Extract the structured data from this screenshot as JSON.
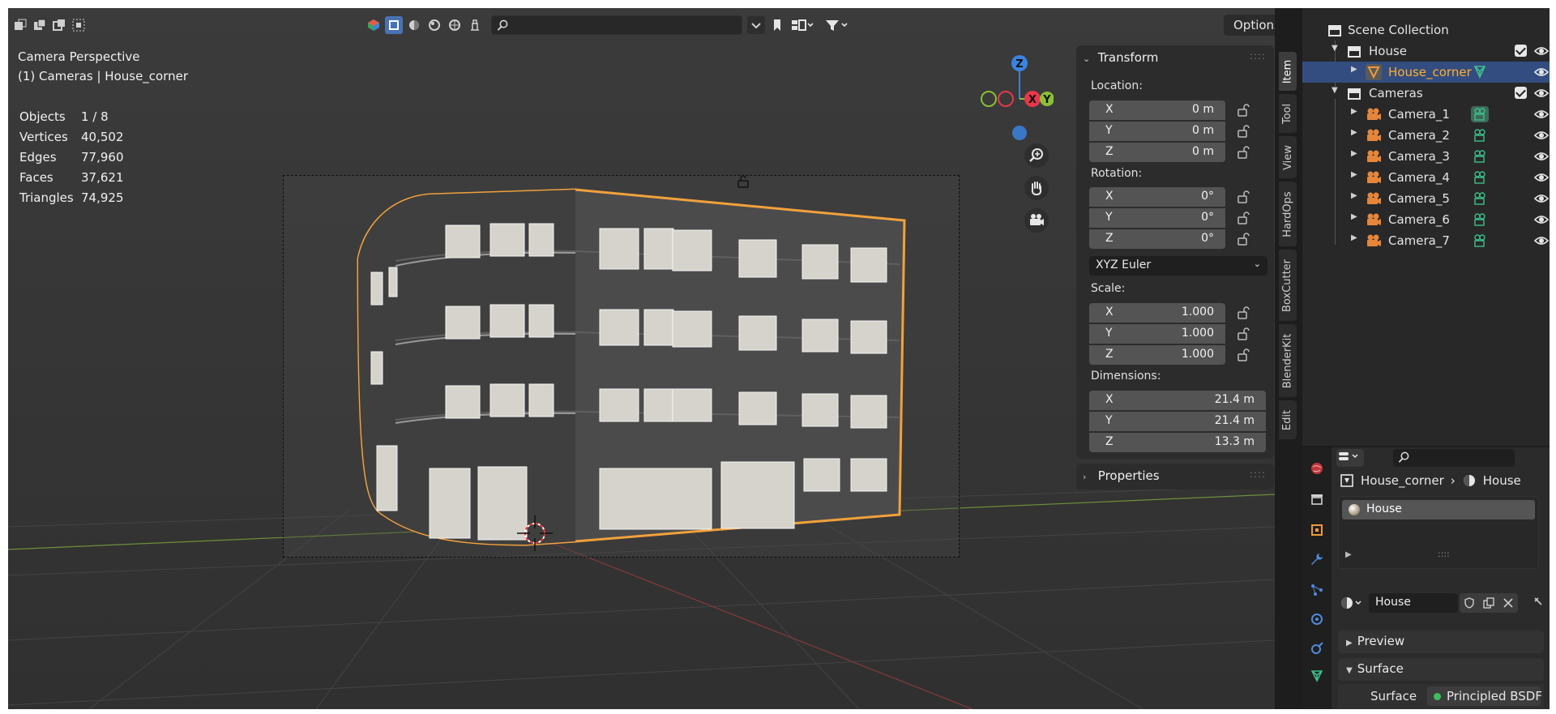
{
  "viewport": {
    "mode_label": "Camera Perspective",
    "context_label": "(1) Cameras | House_corner",
    "stats": [
      {
        "label": "Objects",
        "value": "1 / 8"
      },
      {
        "label": "Vertices",
        "value": "40,502"
      },
      {
        "label": "Edges",
        "value": "77,960"
      },
      {
        "label": "Faces",
        "value": "37,621"
      },
      {
        "label": "Triangles",
        "value": "74,925"
      }
    ],
    "options_label": "Options",
    "gizmo": {
      "x": "X",
      "y": "Y",
      "z": "Z"
    }
  },
  "npanel": {
    "transform": {
      "title": "Transform",
      "location_label": "Location:",
      "location": [
        {
          "axis": "X",
          "value": "0 m"
        },
        {
          "axis": "Y",
          "value": "0 m"
        },
        {
          "axis": "Z",
          "value": "0 m"
        }
      ],
      "rotation_label": "Rotation:",
      "rotation": [
        {
          "axis": "X",
          "value": "0°"
        },
        {
          "axis": "Y",
          "value": "0°"
        },
        {
          "axis": "Z",
          "value": "0°"
        }
      ],
      "rotation_mode": "XYZ Euler",
      "scale_label": "Scale:",
      "scale": [
        {
          "axis": "X",
          "value": "1.000"
        },
        {
          "axis": "Y",
          "value": "1.000"
        },
        {
          "axis": "Z",
          "value": "1.000"
        }
      ],
      "dimensions_label": "Dimensions:",
      "dimensions": [
        {
          "axis": "X",
          "value": "21.4 m"
        },
        {
          "axis": "Y",
          "value": "21.4 m"
        },
        {
          "axis": "Z",
          "value": "13.3 m"
        }
      ]
    },
    "properties_title": "Properties",
    "tabs": [
      "Item",
      "Tool",
      "View",
      "HardOps",
      "BoxCutter",
      "BlenderKit",
      "Edit"
    ]
  },
  "outliner": {
    "root": "Scene Collection",
    "house_collection": "House",
    "house_object": "House_corner",
    "cameras_collection": "Cameras",
    "cameras": [
      "Camera_1",
      "Camera_2",
      "Camera_3",
      "Camera_4",
      "Camera_5",
      "Camera_6",
      "Camera_7"
    ]
  },
  "properties": {
    "breadcrumb_object": "House_corner",
    "breadcrumb_material": "House",
    "material_slot": "House",
    "material_name": "House",
    "preview_label": "Preview",
    "surface_section": "Surface",
    "surface_label": "Surface",
    "surface_value": "Principled BSDF"
  },
  "colors": {
    "accent": "#4772b3",
    "selection_orange": "#ffaf29",
    "axis_x": "#e8374b",
    "axis_y": "#8bbf35",
    "axis_z": "#3b83e0",
    "camera_icon": "#e6863a",
    "data_icon": "#3dbf8a"
  }
}
